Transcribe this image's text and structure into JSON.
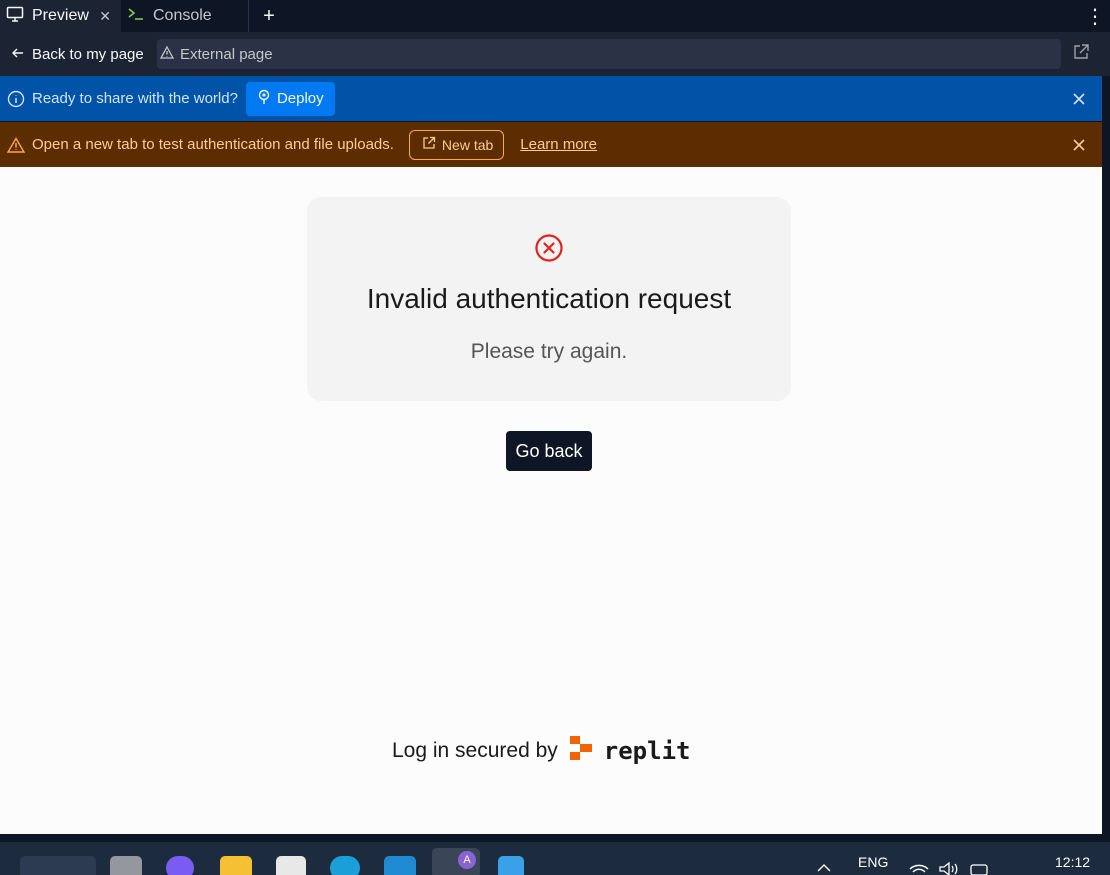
{
  "tabs": [
    {
      "label": "Preview",
      "icon": "monitor-icon",
      "active": true
    },
    {
      "label": "Console",
      "icon": "terminal-icon",
      "active": false
    }
  ],
  "nav": {
    "back_label": "Back to my page",
    "url_label": "External page"
  },
  "deploy_banner": {
    "message": "Ready to share with the world?",
    "button_label": "Deploy",
    "color": "#0053a6"
  },
  "auth_banner": {
    "message": "Open a new tab to test authentication and file uploads.",
    "button_label": "New tab",
    "link_label": "Learn more",
    "color": "#5c2d00"
  },
  "error_card": {
    "title": "Invalid authentication request",
    "subtitle": "Please try again.",
    "icon": "error-circle-icon",
    "icon_color": "#e52222"
  },
  "go_back_label": "Go back",
  "footer": {
    "secured_text": "Log in secured by",
    "brand": "replit",
    "brand_color": "#f26207"
  },
  "taskbar": {
    "language": "ENG",
    "time": "12:12",
    "profile_badge": "A"
  }
}
